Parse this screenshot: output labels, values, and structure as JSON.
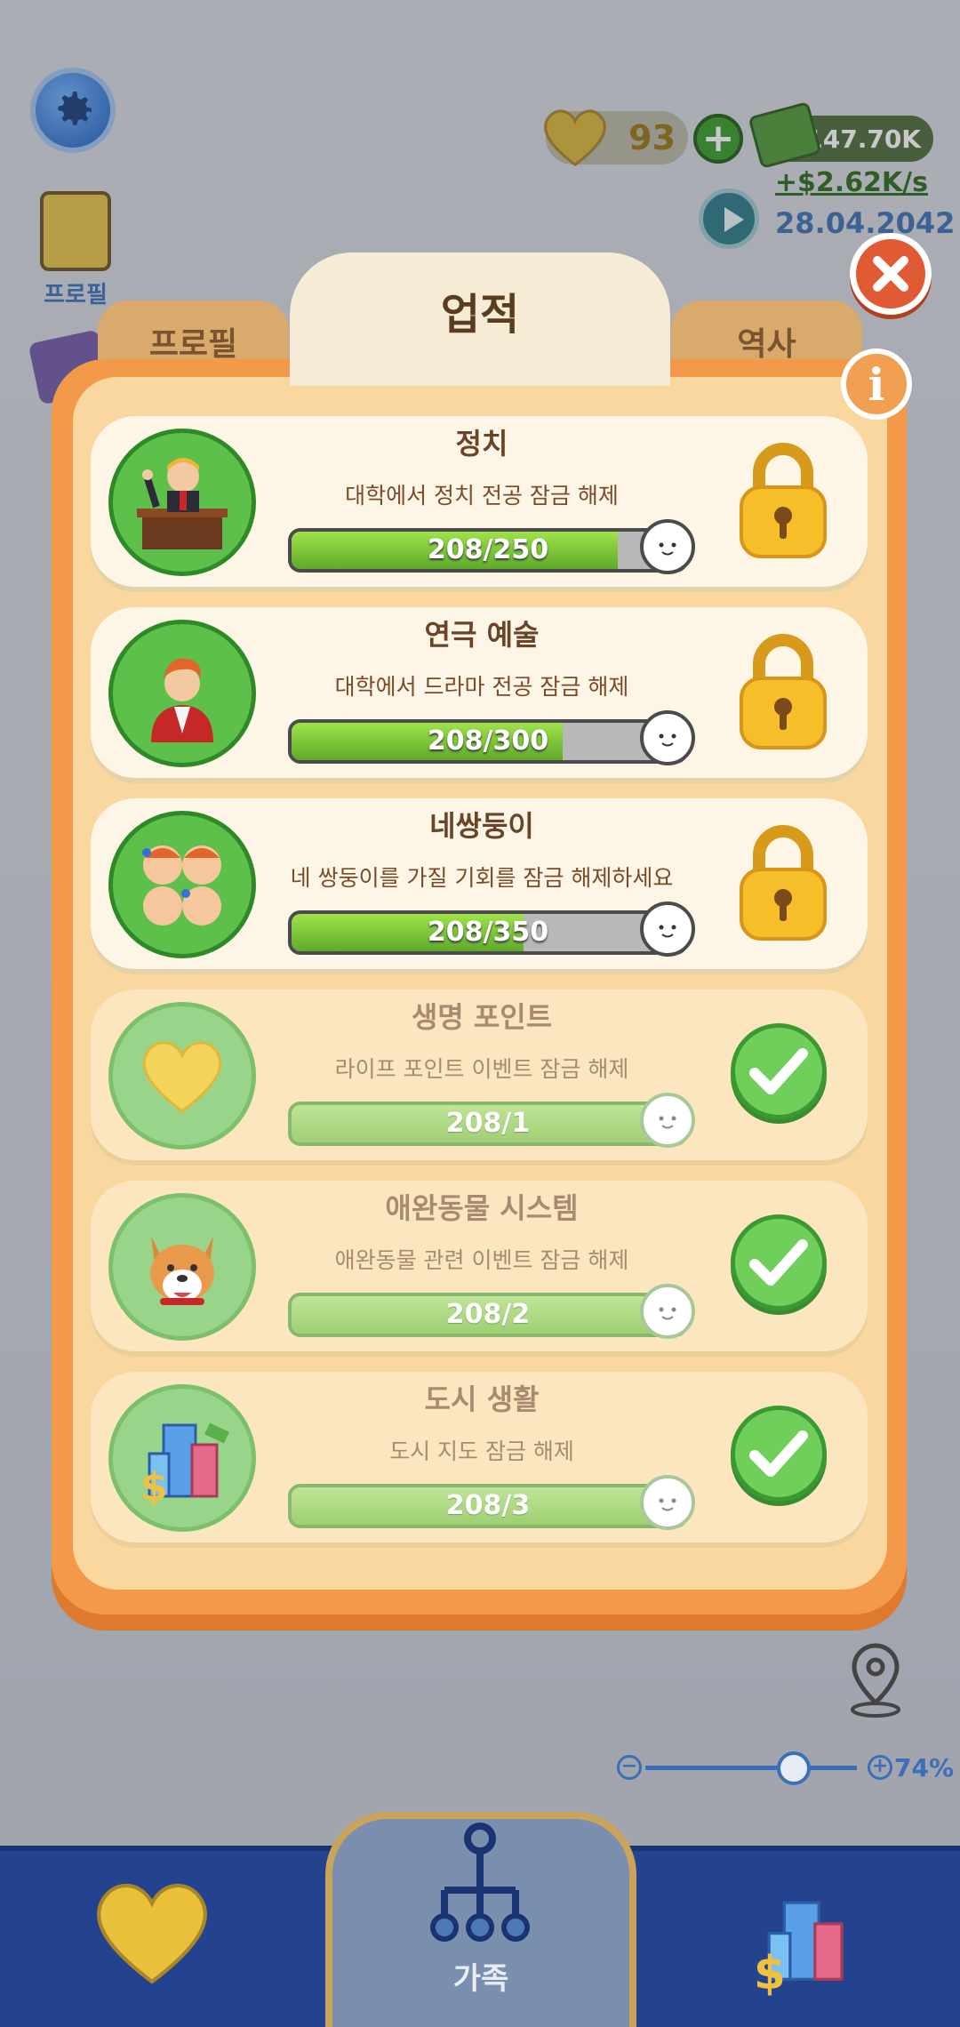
{
  "hud": {
    "hearts": "93",
    "money": "$147.70K",
    "income": "+$2.62K/s",
    "date": "28.04.2042",
    "side_profile_label": "프로필"
  },
  "modal": {
    "tabs": {
      "left": "프로필",
      "active": "업적",
      "right": "역사"
    },
    "achievements": [
      {
        "title": "정치",
        "desc": "대학에서 정치 전공 잠금 해제",
        "progress": "208/250",
        "fill": 0.83,
        "state": "locked",
        "icon": "politician-icon"
      },
      {
        "title": "연극 예술",
        "desc": "대학에서 드라마 전공 잠금 해제",
        "progress": "208/300",
        "fill": 0.69,
        "state": "locked",
        "icon": "actor-icon"
      },
      {
        "title": "네쌍둥이",
        "desc": "네 쌍둥이를 가질 기회를 잠금 해제하세요",
        "progress": "208/350",
        "fill": 0.59,
        "state": "locked",
        "icon": "quadruplets-icon"
      },
      {
        "title": "생명 포인트",
        "desc": "라이프 포인트 이벤트 잠금 해제",
        "progress": "208/1",
        "fill": 1,
        "state": "done",
        "icon": "heart-icon"
      },
      {
        "title": "애완동물 시스템",
        "desc": "애완동물 관련 이벤트 잠금 해제",
        "progress": "208/2",
        "fill": 1,
        "state": "done",
        "icon": "dog-icon"
      },
      {
        "title": "도시 생활",
        "desc": "도시 지도 잠금 해제",
        "progress": "208/3",
        "fill": 1,
        "state": "done",
        "icon": "city-icon"
      }
    ]
  },
  "zoom": {
    "level": "74%"
  },
  "nav": {
    "center_label": "가족"
  },
  "colors": {
    "panel": "#f39a4a",
    "card": "#fdf6e6",
    "progress_green": "#5eaa2a",
    "nav_blue": "#24438f"
  }
}
